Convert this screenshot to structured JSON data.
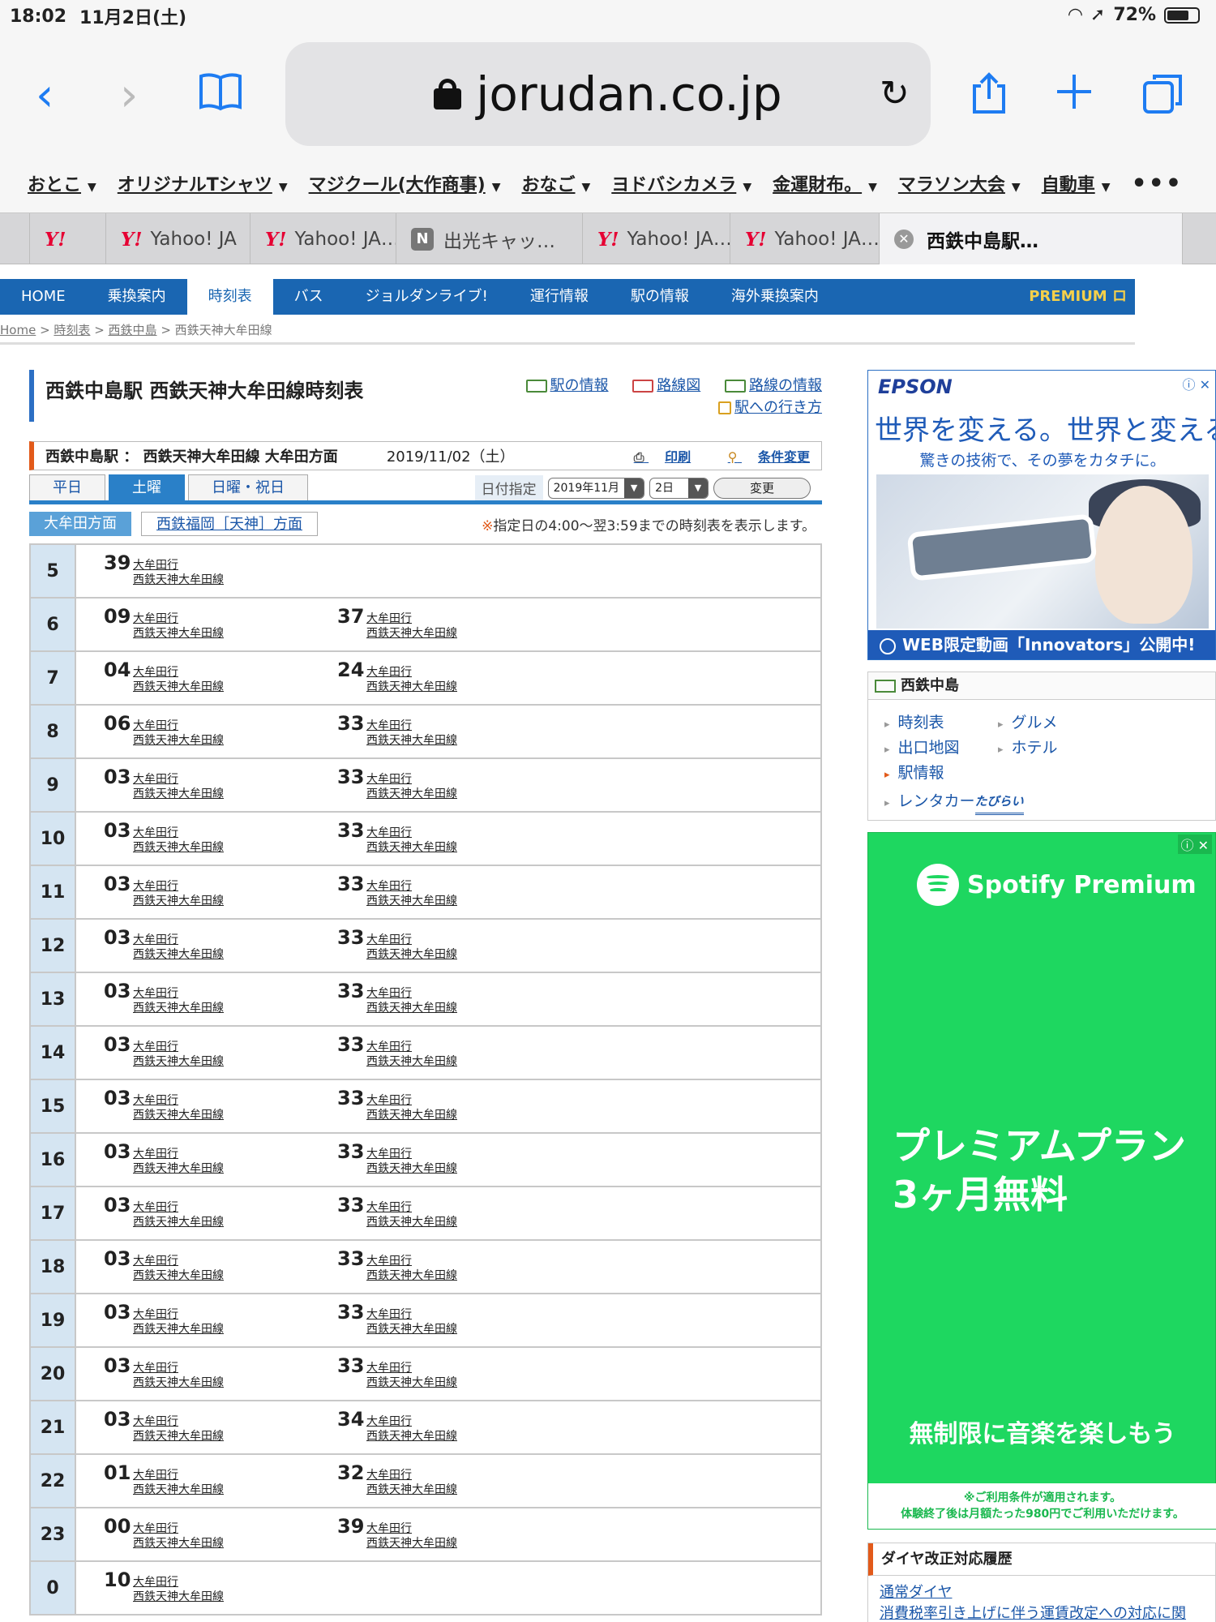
{
  "status": {
    "time": "18:02",
    "date": "11月2日(土)",
    "battery": "72%",
    "battery_level": 0.72
  },
  "browser": {
    "url": "jorudan.co.jp",
    "bookmarks": [
      "おとこ",
      "オリジナルTシャツ",
      "マジクール(大作商事)",
      "おなご",
      "ヨドバシカメラ",
      "金運財布。",
      "マラソン大会",
      "自動車"
    ],
    "more": "•••",
    "tabs": [
      {
        "label": "",
        "icon": "yahoo-y"
      },
      {
        "label": "Yahoo! JA",
        "icon": "yahoo-y"
      },
      {
        "label": "Yahoo! JA…",
        "icon": "yahoo-y"
      },
      {
        "label": "出光キャッ…",
        "icon": "n-icon"
      },
      {
        "label": "Yahoo! JA…",
        "icon": "yahoo-y"
      },
      {
        "label": "Yahoo! JA…",
        "icon": "yahoo-y"
      },
      {
        "label": "西鉄中島駅…",
        "icon": "close"
      }
    ]
  },
  "site": {
    "nav": [
      "HOME",
      "乗換案内",
      "時刻表",
      "バス",
      "ジョルダンライブ!",
      "運行情報",
      "駅の情報",
      "海外乗換案内"
    ],
    "nav_active": 2,
    "premium": "PREMIUM ロ",
    "breadcrumb": {
      "home": "Home",
      "timetable": "時刻表",
      "station": "西鉄中島",
      "current": "西鉄天神大牟田線"
    }
  },
  "main": {
    "title": "西鉄中島駅 西鉄天神大牟田線時刻表",
    "links": {
      "station_info": "駅の情報",
      "route_map": "路線図",
      "route_info": "路線の情報",
      "access": "駅への行き方"
    },
    "info": {
      "station_line": "西鉄中島駅 ： 西鉄天神大牟田線 大牟田方面",
      "date": "2019/11/02（土）",
      "print": "印刷",
      "change_cond": "条件変更"
    },
    "day_tabs": [
      "平日",
      "土曜",
      "日曜・祝日"
    ],
    "day_active": 1,
    "date_picker": {
      "label": "日付指定",
      "month": "2019年11月",
      "day": "2日",
      "button": "変更"
    },
    "directions": {
      "active": "大牟田方面",
      "other": "西鉄福岡［天神］方面"
    },
    "note_mark": "※",
    "note": "指定日の4:00〜翌3:59までの時刻表を表示します。",
    "dest": "大牟田行",
    "line": "西鉄天神大牟田線",
    "timetable": [
      {
        "hour": "5",
        "mins": [
          "39"
        ]
      },
      {
        "hour": "6",
        "mins": [
          "09",
          "37"
        ]
      },
      {
        "hour": "7",
        "mins": [
          "04",
          "24"
        ]
      },
      {
        "hour": "8",
        "mins": [
          "06",
          "33"
        ]
      },
      {
        "hour": "9",
        "mins": [
          "03",
          "33"
        ]
      },
      {
        "hour": "10",
        "mins": [
          "03",
          "33"
        ]
      },
      {
        "hour": "11",
        "mins": [
          "03",
          "33"
        ]
      },
      {
        "hour": "12",
        "mins": [
          "03",
          "33"
        ]
      },
      {
        "hour": "13",
        "mins": [
          "03",
          "33"
        ]
      },
      {
        "hour": "14",
        "mins": [
          "03",
          "33"
        ]
      },
      {
        "hour": "15",
        "mins": [
          "03",
          "33"
        ]
      },
      {
        "hour": "16",
        "mins": [
          "03",
          "33"
        ]
      },
      {
        "hour": "17",
        "mins": [
          "03",
          "33"
        ]
      },
      {
        "hour": "18",
        "mins": [
          "03",
          "33"
        ]
      },
      {
        "hour": "19",
        "mins": [
          "03",
          "33"
        ]
      },
      {
        "hour": "20",
        "mins": [
          "03",
          "33"
        ]
      },
      {
        "hour": "21",
        "mins": [
          "03",
          "34"
        ]
      },
      {
        "hour": "22",
        "mins": [
          "01",
          "32"
        ]
      },
      {
        "hour": "23",
        "mins": [
          "00",
          "39"
        ]
      },
      {
        "hour": "0",
        "mins": [
          "10"
        ]
      }
    ]
  },
  "side": {
    "epson": {
      "brand": "EPSON",
      "headline": "世界を変える。世界と変える。",
      "sub": "驚きの技術で、その夢をカタチに。",
      "footer": "WEB限定動画「Innovators」公開中!"
    },
    "station_box": {
      "title": "西鉄中島",
      "items": [
        "時刻表",
        "グルメ",
        "出口地図",
        "ホテル",
        "駅情報",
        "レンタカー"
      ],
      "tabirai": "たびらい"
    },
    "spotify": {
      "brand": "Spotify Premium",
      "headline1": "プレミアムプラン",
      "headline2": "3ヶ月無料",
      "middle": "無制限に音楽を楽しもう",
      "fine1": "※ご利用条件が適用されます。",
      "fine2": "体験終了後は月額たった980円でご利用いただけます。"
    },
    "history": {
      "title": "ダイヤ改正対応履歴",
      "items": [
        "通常ダイヤ",
        "消費税率引き上げに伴う運賃改定への対応に関"
      ]
    }
  }
}
